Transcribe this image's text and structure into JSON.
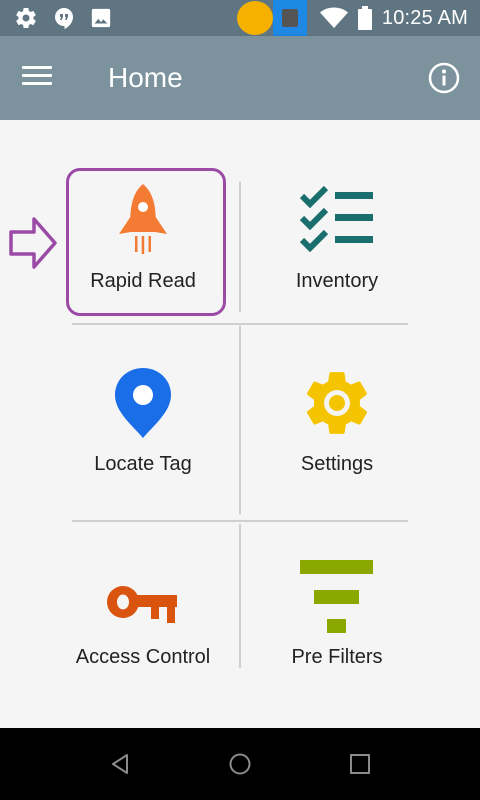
{
  "status_bar": {
    "time": "10:25 AM",
    "icons": [
      "gear-icon",
      "hangouts-icon",
      "image-icon",
      "wifi-icon",
      "battery-icon"
    ]
  },
  "app_bar": {
    "title": "Home",
    "menu_icon": "hamburger-menu-icon",
    "info_icon": "info-icon",
    "background": "#7c939e"
  },
  "tiles": [
    {
      "label": "Rapid Read",
      "icon": "rocket-icon",
      "color": "#f47b33",
      "highlighted": true
    },
    {
      "label": "Inventory",
      "icon": "checklist-icon",
      "color": "#1a6e6e"
    },
    {
      "label": "Locate Tag",
      "icon": "location-pin-icon",
      "color": "#1a6ee8"
    },
    {
      "label": "Settings",
      "icon": "gear-icon",
      "color": "#f5c400"
    },
    {
      "label": "Access Control",
      "icon": "key-icon",
      "color": "#d9540e"
    },
    {
      "label": "Pre Filters",
      "icon": "filter-icon",
      "color": "#8ba800"
    }
  ],
  "highlight_color": "#9b4aa6",
  "nav_bar": {
    "icons": [
      "back-icon",
      "home-icon",
      "recents-icon"
    ]
  }
}
